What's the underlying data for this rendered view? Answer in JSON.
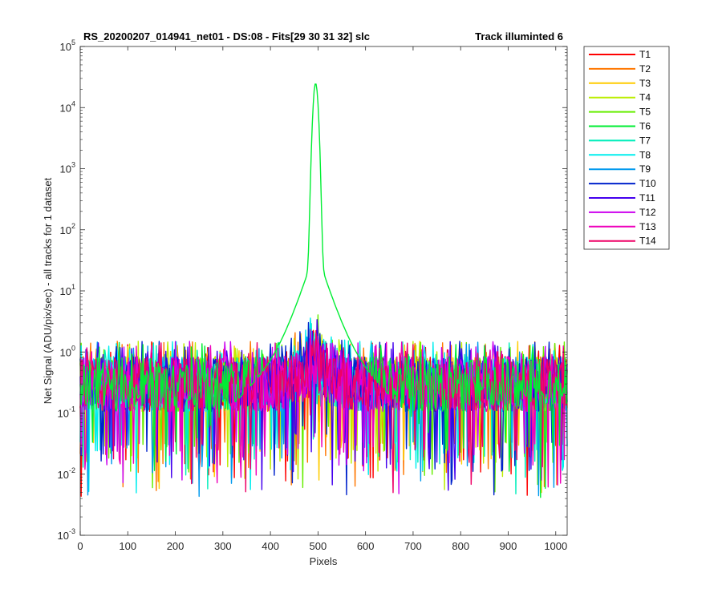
{
  "chart_data": {
    "type": "line",
    "title_left": "RS_20200207_014941_net01 - DS:08 - Fits[29  30  31  32]   slc",
    "title_right": "Track illuminted 6",
    "xlabel": "Pixels",
    "ylabel": "Net Signal (ADU/pix/sec) - all tracks for 1 dataset",
    "xlim": [
      0,
      1024
    ],
    "ylim": [
      0.001,
      100000
    ],
    "yscale": "log",
    "grid": false,
    "legend": "outside-top-right",
    "x_ticks": [
      0,
      100,
      200,
      300,
      400,
      500,
      600,
      700,
      800,
      900,
      1000
    ],
    "x_tick_labels": [
      "0",
      "100",
      "200",
      "300",
      "400",
      "500",
      "600",
      "700",
      "800",
      "900",
      "1000"
    ],
    "y_ticks": [
      {
        "value": 0.001,
        "base": "10",
        "exp": "-3"
      },
      {
        "value": 0.01,
        "base": "10",
        "exp": "-2"
      },
      {
        "value": 0.1,
        "base": "10",
        "exp": "-1"
      },
      {
        "value": 1,
        "base": "10",
        "exp": "0"
      },
      {
        "value": 10,
        "base": "10",
        "exp": "1"
      },
      {
        "value": 100,
        "base": "10",
        "exp": "2"
      },
      {
        "value": 1000,
        "base": "10",
        "exp": "3"
      },
      {
        "value": 10000,
        "base": "10",
        "exp": "4"
      },
      {
        "value": 100000,
        "base": "10",
        "exp": "5"
      }
    ],
    "series": [
      {
        "name": "T1",
        "color": "#ff0000"
      },
      {
        "name": "T2",
        "color": "#ff7700"
      },
      {
        "name": "T3",
        "color": "#ffcc00"
      },
      {
        "name": "T4",
        "color": "#bbee00"
      },
      {
        "name": "T5",
        "color": "#66ee00"
      },
      {
        "name": "T6",
        "color": "#00ee33"
      },
      {
        "name": "T7",
        "color": "#00eebb"
      },
      {
        "name": "T8",
        "color": "#00eeee"
      },
      {
        "name": "T9",
        "color": "#0099ee"
      },
      {
        "name": "T10",
        "color": "#0022cc"
      },
      {
        "name": "T11",
        "color": "#4400ee"
      },
      {
        "name": "T12",
        "color": "#cc00ee"
      },
      {
        "name": "T13",
        "color": "#ee00bb"
      },
      {
        "name": "T14",
        "color": "#ee0066"
      }
    ],
    "peak_series": "T6",
    "peak_x": 495,
    "peak_y": 25000,
    "baseline_median": 0.3,
    "baseline_range": [
      0.003,
      1.6
    ]
  }
}
